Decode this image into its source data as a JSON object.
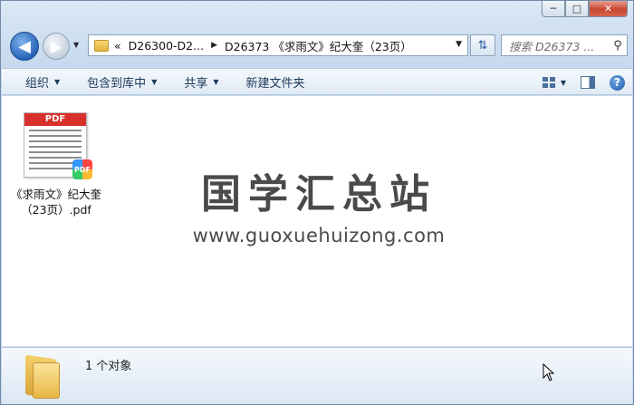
{
  "caption": {
    "minimize": "─",
    "maximize": "□",
    "close": "✕"
  },
  "nav": {
    "back_glyph": "◀",
    "forward_glyph": "▶"
  },
  "address": {
    "overflow": "«",
    "parts": [
      "D26300-D2...",
      "D26373 《求雨文》纪大奎（23页）"
    ],
    "separator": "▶"
  },
  "search": {
    "placeholder": "搜索 D26373 ..."
  },
  "toolbar": {
    "organize": "组织",
    "include_library": "包含到库中",
    "share": "共享",
    "new_folder": "新建文件夹"
  },
  "files": [
    {
      "name": "《求雨文》纪大奎（23页）.pdf",
      "type_label": "PDF",
      "badge": "PDF"
    }
  ],
  "watermark": {
    "title": "国学汇总站",
    "url": "www.guoxuehuizong.com"
  },
  "status": {
    "object_count": "1 个对象"
  },
  "icons": [
    "back-arrow-icon",
    "forward-arrow-icon",
    "folder-icon",
    "refresh-icon",
    "search-icon",
    "view-icon",
    "preview-pane-icon",
    "help-icon",
    "pdf-file-icon",
    "cursor-icon"
  ]
}
